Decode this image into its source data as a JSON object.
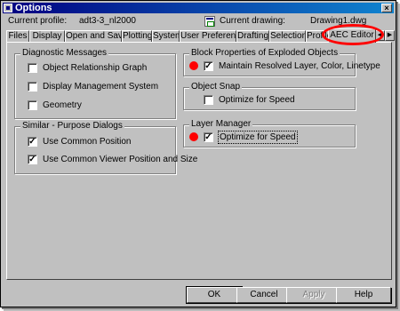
{
  "window": {
    "title": "Options",
    "close_glyph": "×"
  },
  "profile": {
    "current_profile_label": "Current profile:",
    "current_profile_value": "adt3-3_nl2000",
    "current_drawing_label": "Current drawing:",
    "current_drawing_value": "Drawing1.dwg"
  },
  "tabs": [
    {
      "label": "Files"
    },
    {
      "label": "Display"
    },
    {
      "label": "Open and Save"
    },
    {
      "label": "Plotting"
    },
    {
      "label": "System"
    },
    {
      "label": "User Preferences"
    },
    {
      "label": "Drafting"
    },
    {
      "label": "Selection"
    },
    {
      "label": "Profiles"
    },
    {
      "label": "AEC Editor",
      "active": true
    }
  ],
  "tab_scroll": {
    "left_glyph": "◀",
    "right_glyph": "▶"
  },
  "groups": {
    "diagnostic": {
      "title": "Diagnostic Messages",
      "items": [
        {
          "label": "Object Relationship Graph",
          "checked": false
        },
        {
          "label": "Display Management System",
          "checked": false
        },
        {
          "label": "Geometry",
          "checked": false
        }
      ]
    },
    "similar": {
      "title": "Similar - Purpose Dialogs",
      "items": [
        {
          "label": "Use Common Position",
          "checked": true
        },
        {
          "label": "Use Common Viewer Position and Size",
          "checked": true
        }
      ]
    },
    "block": {
      "title": "Block Properties of Exploded Objects",
      "items": [
        {
          "label": "Maintain Resolved Layer, Color, Linetype",
          "checked": true
        }
      ]
    },
    "snap": {
      "title": "Object Snap",
      "items": [
        {
          "label": "Optimize for Speed",
          "checked": false
        }
      ]
    },
    "layer": {
      "title": "Layer Manager",
      "items": [
        {
          "label": "Optimize for Speed",
          "checked": true
        }
      ]
    }
  },
  "check_glyph": "✓",
  "buttons": {
    "ok": "OK",
    "cancel": "Cancel",
    "apply": "Apply",
    "help": "Help"
  },
  "colors": {
    "titlebar": "#000080",
    "face": "#c0c0c0",
    "annotation": "#ff0000"
  }
}
